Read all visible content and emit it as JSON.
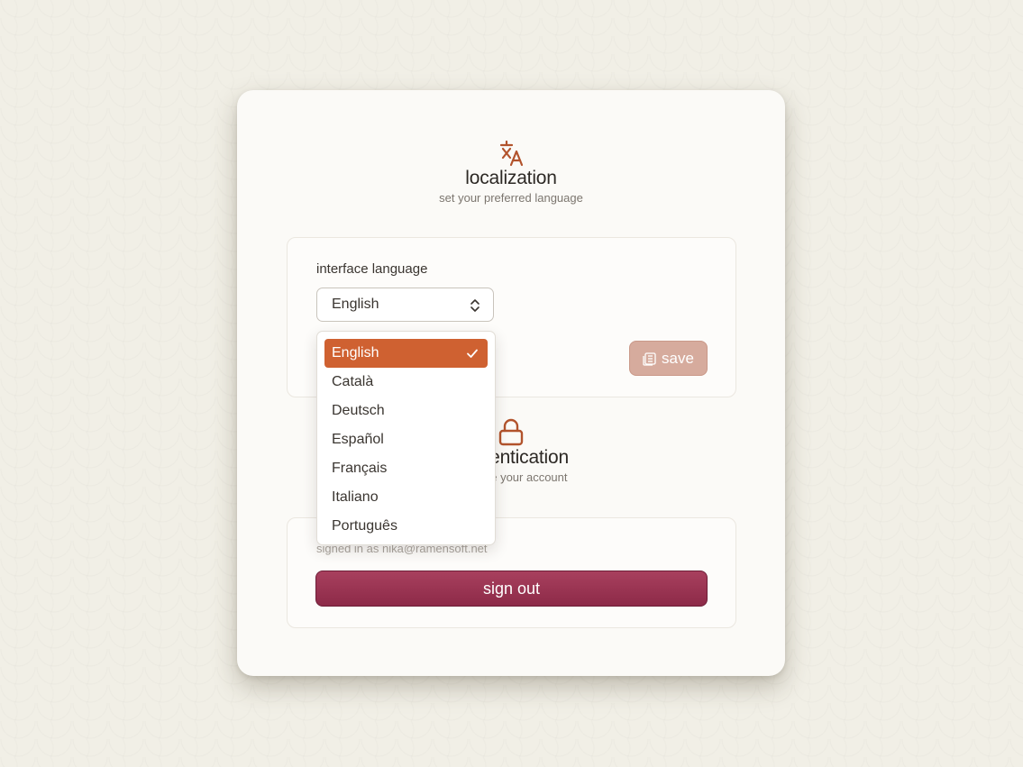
{
  "localization": {
    "icon": "translate-icon",
    "title": "localization",
    "subtitle": "set your preferred language",
    "field_label": "interface language",
    "selected_value": "English",
    "save_label": "save",
    "options": [
      "English",
      "Català",
      "Deutsch",
      "Español",
      "Français",
      "Italiano",
      "Português"
    ]
  },
  "authentication": {
    "icon": "lock-icon",
    "title": "authentication",
    "subtitle": "manage your account",
    "signed_in_text": "signed in as nika@ramensoft.net",
    "sign_out_label": "sign out"
  },
  "colors": {
    "accent": "#cf6131",
    "save_disabled": "#d6ab9d",
    "sign_out": "#9b3553",
    "background": "#f1efe6",
    "card": "#fbfaf7"
  }
}
